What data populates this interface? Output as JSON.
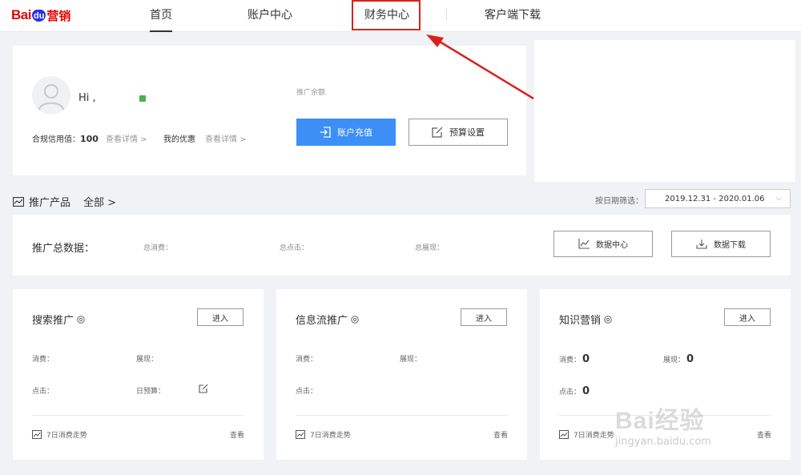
{
  "nav": {
    "logo_bai": "Bai",
    "logo_du": "du",
    "logo_yx": "营销",
    "items": [
      "首页",
      "账户中心",
      "财务中心",
      "客户端下载"
    ]
  },
  "account": {
    "greeting": "Hi ,",
    "credit_label": "合规信用值：",
    "credit_value": "100",
    "detail": "查看详情 >",
    "discount_label": "我的优惠",
    "balance_label": "推广余额",
    "recharge_button": "账户充值",
    "budget_button": "预算设置"
  },
  "products": {
    "title": "推广产品",
    "all": "全部 >",
    "date_label": "按日期筛选：",
    "date_range": "2019.12.31 - 2020.01.06"
  },
  "totals": {
    "title": "推广总数据：",
    "spend": "总消费：",
    "clicks": "总点击：",
    "impressions": "总展现："
  },
  "cards": [
    {
      "title": "搜索推广",
      "enter": "进入",
      "spend_label": "消费：",
      "spend_value": "",
      "show_label": "展现：",
      "show_value": "",
      "click_label": "点击：",
      "click_value": "",
      "budget_label": "日预算：",
      "trend": "7日消费走势",
      "view": "查看"
    },
    {
      "title": "信息流推广",
      "enter": "进入",
      "spend_label": "消费：",
      "spend_value": "",
      "show_label": "展现：",
      "show_value": "",
      "click_label": "点击：",
      "click_value": "",
      "trend": "7日消费走势",
      "view": "查看"
    },
    {
      "title": "知识营销",
      "enter": "进入",
      "spend_label": "消费：",
      "spend_value": "0",
      "show_label": "展现：",
      "show_value": "0",
      "click_label": "点击：",
      "click_value": "0",
      "trend": "7日消费走势",
      "view": "查看"
    }
  ],
  "watermark": {
    "main": "Bai经验",
    "sub": "jingyan.baidu.com"
  },
  "colors": {
    "primary": "#3c8ff5",
    "highlight": "#d9221b",
    "status": "#4caf50"
  }
}
